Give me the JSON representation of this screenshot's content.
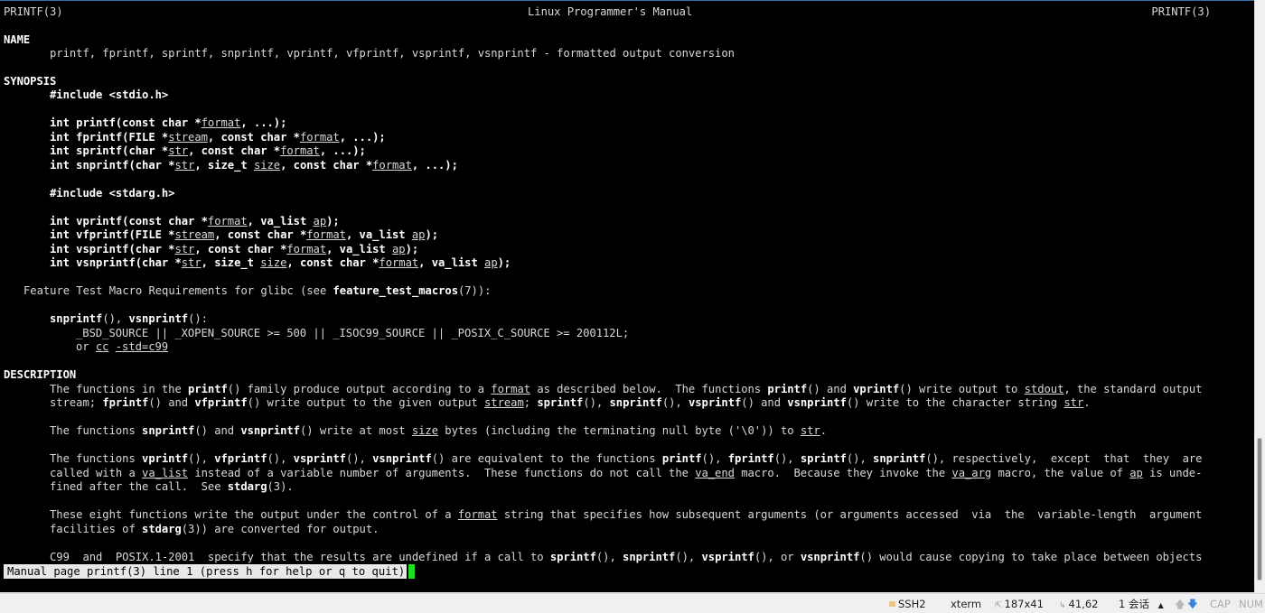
{
  "terminal": {
    "header": {
      "left": "PRINTF(3)",
      "center": "Linux Programmer's Manual",
      "right": "PRINTF(3)"
    },
    "sections": {
      "name": "NAME",
      "synopsis": "SYNOPSIS",
      "description": "DESCRIPTION"
    },
    "name_line": "printf, fprintf, sprintf, snprintf, vprintf, vfprintf, vsprintf, vsnprintf - formatted output conversion",
    "include_stdio": "#include <stdio.h>",
    "include_stdarg": "#include <stdarg.h>",
    "feature_test_prefix": "Feature Test Macro Requirements for glibc (see ",
    "feature_test_link": "feature_test_macros",
    "feature_test_suffix": "(7)):",
    "ftm_funcs_1": "snprintf",
    "ftm_funcs_sep": "(), ",
    "ftm_funcs_2": "vsnprintf",
    "ftm_funcs_end": "():",
    "ftm_macros": "_BSD_SOURCE || _XOPEN_SOURCE >= 500 || _ISOC99_SOURCE || _POSIX_C_SOURCE >= 200112L;",
    "ftm_or": "or ",
    "ftm_cc": "cc",
    "ftm_std": "-std=c99"
  },
  "prompt": {
    "text": "Manual page printf(3) line 1 (press h for help or q to quit)"
  },
  "statusbar": {
    "protocol": "SSH2",
    "terminal_type": "xterm",
    "size": "187x41",
    "cursor_pos": "41,62",
    "sessions": "1 会话",
    "cap": "CAP",
    "num": "NUM"
  }
}
